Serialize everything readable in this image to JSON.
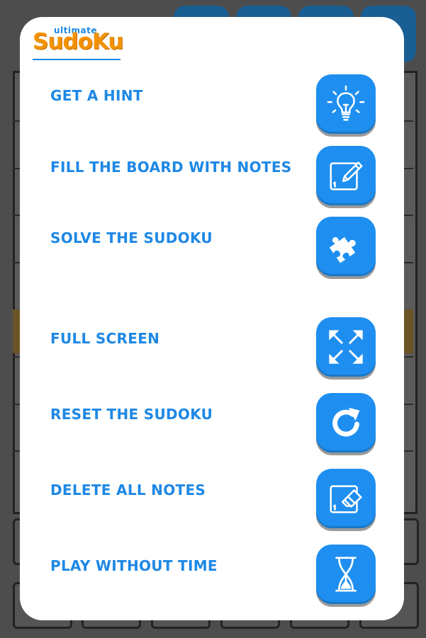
{
  "app": {
    "logo_top": "ultimate",
    "logo_main": "SudoKu"
  },
  "menu": {
    "items": [
      {
        "label": "GET A HINT",
        "icon": "lightbulb-icon"
      },
      {
        "label": "FILL THE BOARD WITH NOTES",
        "icon": "pencil-notes-icon"
      },
      {
        "label": "SOLVE THE SUDOKU",
        "icon": "puzzle-piece-icon"
      },
      {
        "label": "FULL SCREEN",
        "icon": "fullscreen-arrows-icon"
      },
      {
        "label": "RESET THE SUDOKU",
        "icon": "reset-arrow-icon"
      },
      {
        "label": "DELETE ALL NOTES",
        "icon": "eraser-notes-icon"
      },
      {
        "label": "PLAY WITHOUT TIME",
        "icon": "hourglass-icon"
      }
    ]
  },
  "colors": {
    "accent": "#1e88e5",
    "button": "#1e8ff0",
    "logo": "#f39200"
  }
}
